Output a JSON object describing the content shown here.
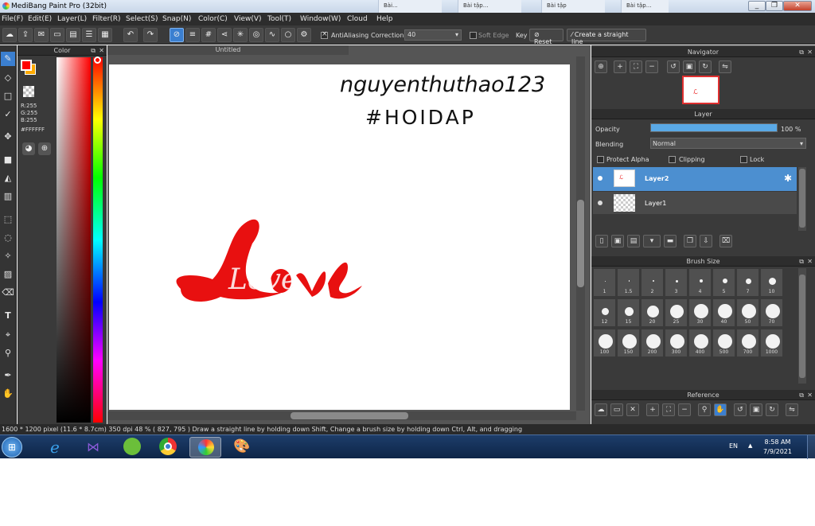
{
  "window": {
    "title": "MediBang Paint Pro (32bit)",
    "tabs": [
      "Bài...",
      "Bài tập...",
      "Bài tập",
      "Bài tập..."
    ]
  },
  "menu": [
    "File(F)",
    "Edit(E)",
    "Layer(L)",
    "Filter(R)",
    "Select(S)",
    "Snap(N)",
    "Color(C)",
    "View(V)",
    "Tool(T)",
    "Window(W)",
    "Cloud",
    "Help"
  ],
  "toolbar": {
    "antialiasing_label": "AntiAliasing",
    "correction_label": "Correction",
    "correction_value": "40",
    "soft_edge_label": "Soft Edge",
    "key_label": "Key",
    "reset_label": "Reset",
    "straight_line_label": "Create a straight line"
  },
  "color_panel": {
    "title": "Color",
    "r": "R:255",
    "g": "G:255",
    "b": "B:255",
    "hex": "#FFFFFF"
  },
  "canvas": {
    "doc_title": "Untitled",
    "handwriting_line1": "nguyenthuthao123",
    "handwriting_line2": "#HOIDAP",
    "drawing_text": "Love",
    "drawing_color": "#e81010"
  },
  "navigator": {
    "title": "Navigator"
  },
  "layer_panel": {
    "title": "Layer",
    "opacity_label": "Opacity",
    "opacity_value": "100 %",
    "opacity_fraction": 1.0,
    "blending_label": "Blending",
    "blending_value": "Normal",
    "protect_alpha_label": "Protect Alpha",
    "clipping_label": "Clipping",
    "lock_label": "Lock",
    "layers": [
      {
        "name": "Layer2",
        "selected": true
      },
      {
        "name": "Layer1",
        "selected": false
      }
    ]
  },
  "brush_size": {
    "title": "Brush Size",
    "sizes": [
      "1",
      "1.5",
      "2",
      "3",
      "4",
      "5",
      "7",
      "10",
      "12",
      "15",
      "20",
      "25",
      "30",
      "40",
      "50",
      "70",
      "100",
      "150",
      "200",
      "300",
      "400",
      "500",
      "700",
      "1000"
    ]
  },
  "reference": {
    "title": "Reference"
  },
  "status": {
    "text": "1600 * 1200 pixel   (11.6 * 8.7cm)   350 dpi   48 %   ( 827, 795 )   Draw a straight line by holding down Shift, Change a brush size by holding down Ctrl, Alt, and dragging"
  },
  "taskbar": {
    "lang": "EN",
    "time": "8:58 AM",
    "date": "7/9/2021"
  },
  "colors": {
    "accent": "#3b7fd0",
    "panel": "#3a3a3a",
    "foreground_color": "#ff0000",
    "background_color": "#ffaa00"
  }
}
